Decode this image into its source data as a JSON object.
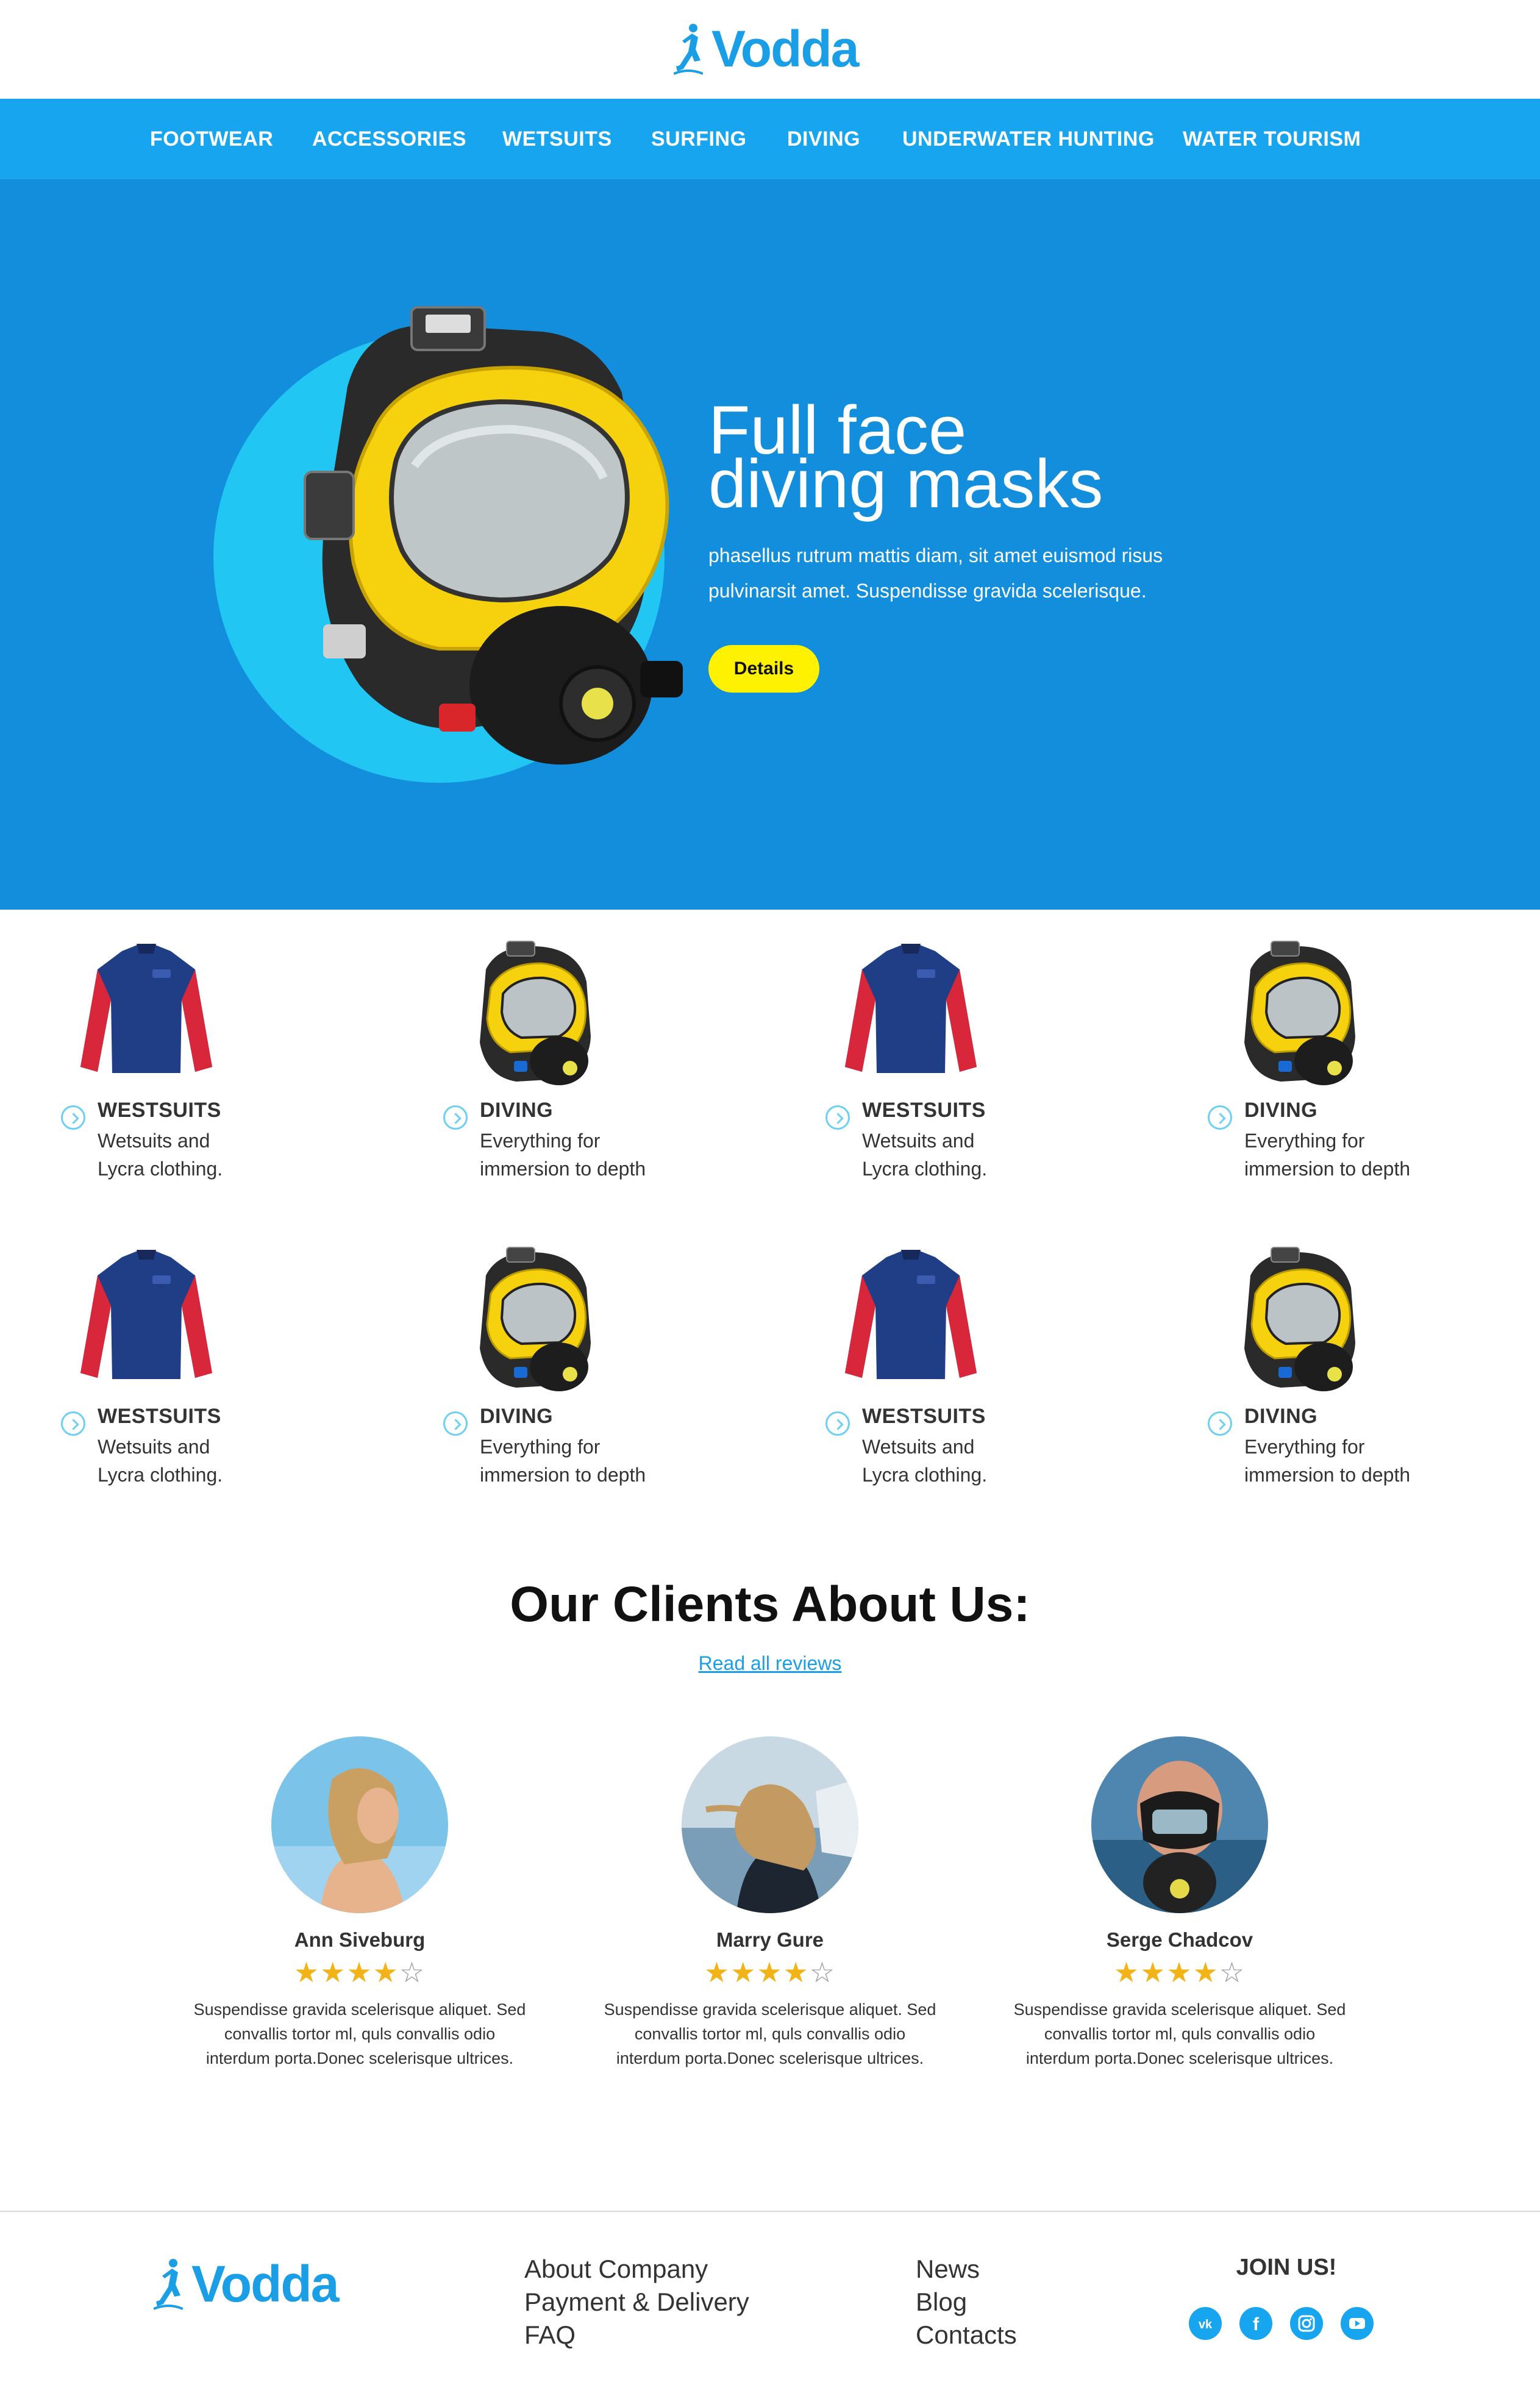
{
  "brand": {
    "name": "Vodda",
    "color": "#1a9ee6"
  },
  "nav": {
    "items": [
      "FOOTWEAR",
      "ACCESSORIES",
      "WETSUITS",
      "SURFING",
      "DIVING",
      "UNDERWATER HUNTING",
      "WATER TOURISM"
    ],
    "background": "#17a5ef"
  },
  "hero": {
    "title_line1": "Full face",
    "title_line2": "diving masks",
    "description_line1": "phasellus rutrum mattis diam, sit amet euismod risus",
    "description_line2": "pulvinarsit amet. Suspendisse gravida scelerisque.",
    "button_label": "Details",
    "background": "#128edd",
    "button_color": "#fff200"
  },
  "products": [
    {
      "category": "WESTSUITS",
      "line1": "Wetsuits and",
      "line2": "Lycra clothing.",
      "image": "wetsuit"
    },
    {
      "category": "DIVING",
      "line1": "Everything for",
      "line2": "immersion to depth",
      "image": "diving-mask"
    },
    {
      "category": "WESTSUITS",
      "line1": "Wetsuits and",
      "line2": "Lycra clothing.",
      "image": "wetsuit"
    },
    {
      "category": "DIVING",
      "line1": "Everything for",
      "line2": "immersion to depth",
      "image": "diving-mask"
    },
    {
      "category": "WESTSUITS",
      "line1": "Wetsuits and",
      "line2": "Lycra clothing.",
      "image": "wetsuit"
    },
    {
      "category": "DIVING",
      "line1": "Everything for",
      "line2": "immersion to depth",
      "image": "diving-mask"
    },
    {
      "category": "WESTSUITS",
      "line1": "Wetsuits and",
      "line2": "Lycra clothing.",
      "image": "wetsuit"
    },
    {
      "category": "DIVING",
      "line1": "Everything for",
      "line2": "immersion to depth",
      "image": "diving-mask"
    }
  ],
  "reviews": {
    "title": "Our Clients About Us:",
    "link_label": "Read all reviews",
    "items": [
      {
        "name": "Ann Siveburg",
        "rating": 4,
        "max_rating": 5,
        "text_line1": "Suspendisse gravida scelerisque aliquet. Sed",
        "text_line2": "convallis tortor ml, quls convallis odio",
        "text_line3": "interdum porta.Donec scelerisque ultrices."
      },
      {
        "name": "Marry Gure",
        "rating": 4,
        "max_rating": 5,
        "text_line1": "Suspendisse gravida scelerisque aliquet. Sed",
        "text_line2": "convallis tortor ml, quls convallis odio",
        "text_line3": "interdum porta.Donec scelerisque ultrices."
      },
      {
        "name": "Serge Chadcov",
        "rating": 4,
        "max_rating": 5,
        "text_line1": "Suspendisse gravida scelerisque aliquet. Sed",
        "text_line2": "convallis tortor ml, quls convallis odio",
        "text_line3": "interdum porta.Donec scelerisque ultrices."
      }
    ]
  },
  "footer": {
    "col1": [
      "About Company",
      "Payment & Delivery",
      "FAQ"
    ],
    "col2": [
      "News",
      "Blog",
      "Contacts"
    ],
    "join_label": "JOIN US!",
    "social": [
      "vk-icon",
      "facebook-icon",
      "instagram-icon",
      "youtube-icon"
    ]
  }
}
